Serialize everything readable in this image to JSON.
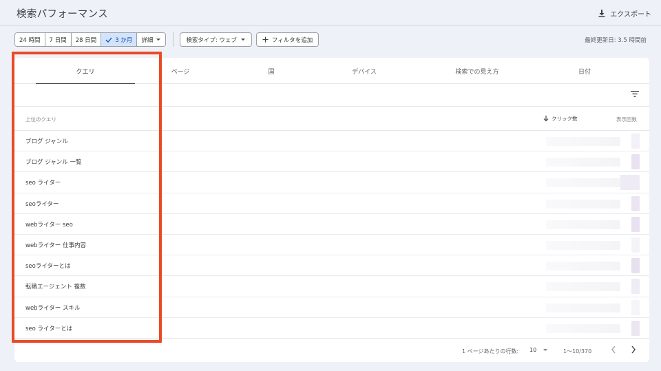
{
  "header": {
    "title": "検索パフォーマンス",
    "export_label": "エクスポート",
    "export_icon": "download-icon"
  },
  "toolbar": {
    "date_ranges": [
      {
        "label": "24 時間",
        "active": false
      },
      {
        "label": "7 日間",
        "active": false
      },
      {
        "label": "28 日間",
        "active": false
      },
      {
        "label": "3 か月",
        "active": true
      }
    ],
    "details_label": "詳細",
    "search_type_label": "検索タイプ: ウェブ",
    "add_filter_label": "フィルタを追加",
    "last_updated": "最終更新日: 3.5 時間前"
  },
  "tabs": [
    {
      "label": "クエリ",
      "selected": true
    },
    {
      "label": "ページ",
      "selected": false
    },
    {
      "label": "国",
      "selected": false
    },
    {
      "label": "デバイス",
      "selected": false
    },
    {
      "label": "検索での見え方",
      "selected": false
    },
    {
      "label": "日付",
      "selected": false
    }
  ],
  "table": {
    "header_query": "上位のクエリ",
    "header_clicks": "クリック数",
    "header_impressions": "表示回数",
    "rows": [
      {
        "query": "ブログ ジャンル"
      },
      {
        "query": "ブログ ジャンル 一覧"
      },
      {
        "query": "seo ライター"
      },
      {
        "query": "seoライター"
      },
      {
        "query": "webライター seo"
      },
      {
        "query": "webライター 仕事内容"
      },
      {
        "query": "seoライターとは"
      },
      {
        "query": "転職エージェント 複数"
      },
      {
        "query": "webライター スキル"
      },
      {
        "query": "seo ライターとは"
      }
    ]
  },
  "pagination": {
    "rows_per_page_label": "1 ページあたりの行数:",
    "rows_per_page_value": "10",
    "range": "1〜10/370"
  },
  "colors": {
    "accent": "#1a73e8",
    "active_chip_bg": "#d2e3fc",
    "highlight": "#ea4a24",
    "impression_tint": "#e6dff0"
  }
}
